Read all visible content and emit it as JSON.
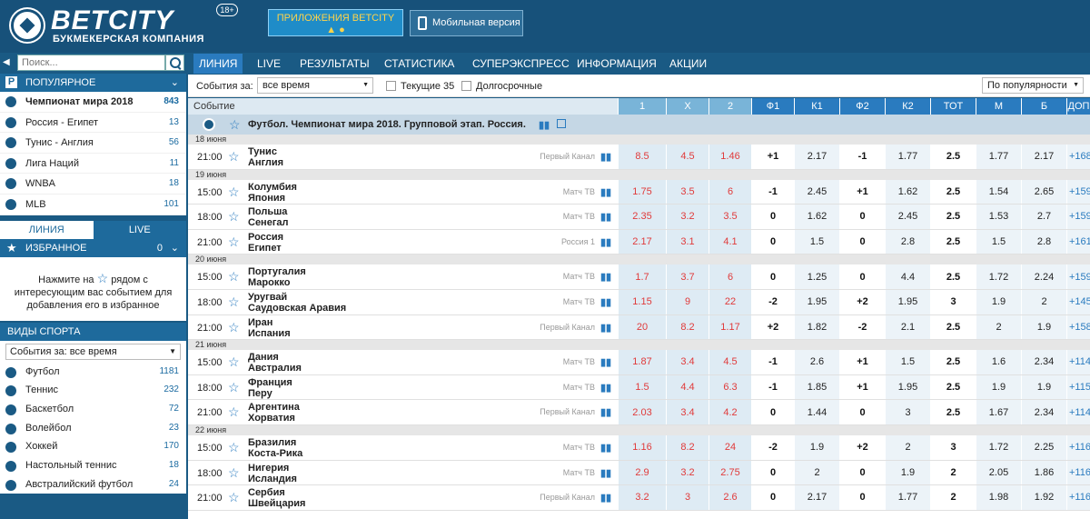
{
  "brand": {
    "name": "BETCITY",
    "subtitle": "БУКМЕКЕРСКАЯ КОМПАНИЯ",
    "age": "18+"
  },
  "header": {
    "apps_label": "ПРИЛОЖЕНИЯ BETCITY",
    "mobile_label": "Мобильная версия"
  },
  "search": {
    "placeholder": "Поиск..."
  },
  "nav": [
    "ЛИНИЯ",
    "LIVE",
    "РЕЗУЛЬТАТЫ",
    "СТАТИСТИКА",
    "СУПЕРЭКСПРЕСС",
    "ИНФОРМАЦИЯ",
    "АКЦИИ"
  ],
  "popular": {
    "title": "ПОПУЛЯРНОЕ",
    "items": [
      {
        "label": "Чемпионат мира 2018",
        "count": "843"
      },
      {
        "label": "Россия - Египет",
        "count": "13"
      },
      {
        "label": "Тунис - Англия",
        "count": "56"
      },
      {
        "label": "Лига Наций",
        "count": "11"
      },
      {
        "label": "WNBA",
        "count": "18"
      },
      {
        "label": "MLB",
        "count": "101"
      }
    ]
  },
  "side_tabs": [
    "ЛИНИЯ",
    "LIVE"
  ],
  "favorites": {
    "title": "ИЗБРАННОЕ",
    "count": "0",
    "hint_1": "Нажмите на",
    "hint_2": "рядом с",
    "hint_3": "интересующим вас событием для",
    "hint_4": "добавления его в избранное"
  },
  "sports": {
    "title": "ВИДЫ СПОРТА",
    "filter": "События за: все время",
    "items": [
      {
        "label": "Футбол",
        "count": "1181"
      },
      {
        "label": "Теннис",
        "count": "232"
      },
      {
        "label": "Баскетбол",
        "count": "72"
      },
      {
        "label": "Волейбол",
        "count": "23"
      },
      {
        "label": "Хоккей",
        "count": "170"
      },
      {
        "label": "Настольный теннис",
        "count": "18"
      },
      {
        "label": "Австралийский футбол",
        "count": "24"
      }
    ]
  },
  "filters": {
    "period_label": "События за:",
    "period_value": "все время",
    "current": "Текущие 35",
    "long": "Долгосрочные",
    "sort": "По популярности"
  },
  "columns": [
    "Событие",
    "1",
    "X",
    "2",
    "Ф1",
    "К1",
    "Ф2",
    "К2",
    "ТОТ",
    "М",
    "Б",
    "ДОП"
  ],
  "league": "Футбол. Чемпионат мира 2018. Групповой этап. Россия.",
  "rows": [
    {
      "date": "18 июня"
    },
    {
      "time": "21:00",
      "t1": "Тунис",
      "t2": "Англия",
      "tv": "Первый Канал",
      "o1": "8.5",
      "ox": "4.5",
      "o2": "1.46",
      "f1": "+1",
      "k1": "2.17",
      "f2": "-1",
      "k2": "1.77",
      "tot": "2.5",
      "m": "1.77",
      "b": "2.17",
      "dop": "+168"
    },
    {
      "date": "19 июня"
    },
    {
      "time": "15:00",
      "t1": "Колумбия",
      "t2": "Япония",
      "tv": "Матч ТВ",
      "o1": "1.75",
      "ox": "3.5",
      "o2": "6",
      "f1": "-1",
      "k1": "2.45",
      "f2": "+1",
      "k2": "1.62",
      "tot": "2.5",
      "m": "1.54",
      "b": "2.65",
      "dop": "+159"
    },
    {
      "time": "18:00",
      "t1": "Польша",
      "t2": "Сенегал",
      "tv": "Матч ТВ",
      "o1": "2.35",
      "ox": "3.2",
      "o2": "3.5",
      "f1": "0",
      "k1": "1.62",
      "f2": "0",
      "k2": "2.45",
      "tot": "2.5",
      "m": "1.53",
      "b": "2.7",
      "dop": "+159"
    },
    {
      "time": "21:00",
      "t1": "Россия",
      "t2": "Египет",
      "tv": "Россия 1",
      "o1": "2.17",
      "ox": "3.1",
      "o2": "4.1",
      "f1": "0",
      "k1": "1.5",
      "f2": "0",
      "k2": "2.8",
      "tot": "2.5",
      "m": "1.5",
      "b": "2.8",
      "dop": "+161"
    },
    {
      "date": "20 июня"
    },
    {
      "time": "15:00",
      "t1": "Португалия",
      "t2": "Марокко",
      "tv": "Матч ТВ",
      "o1": "1.7",
      "ox": "3.7",
      "o2": "6",
      "f1": "0",
      "k1": "1.25",
      "f2": "0",
      "k2": "4.4",
      "tot": "2.5",
      "m": "1.72",
      "b": "2.24",
      "dop": "+159"
    },
    {
      "time": "18:00",
      "t1": "Уругвай",
      "t2": "Саудовская Аравия",
      "tv": "Матч ТВ",
      "o1": "1.15",
      "ox": "9",
      "o2": "22",
      "f1": "-2",
      "k1": "1.95",
      "f2": "+2",
      "k2": "1.95",
      "tot": "3",
      "m": "1.9",
      "b": "2",
      "dop": "+145"
    },
    {
      "time": "21:00",
      "t1": "Иран",
      "t2": "Испания",
      "tv": "Первый Канал",
      "o1": "20",
      "ox": "8.2",
      "o2": "1.17",
      "f1": "+2",
      "k1": "1.82",
      "f2": "-2",
      "k2": "2.1",
      "tot": "2.5",
      "m": "2",
      "b": "1.9",
      "dop": "+158"
    },
    {
      "date": "21 июня"
    },
    {
      "time": "15:00",
      "t1": "Дания",
      "t2": "Австралия",
      "tv": "Матч ТВ",
      "o1": "1.87",
      "ox": "3.4",
      "o2": "4.5",
      "f1": "-1",
      "k1": "2.6",
      "f2": "+1",
      "k2": "1.5",
      "tot": "2.5",
      "m": "1.6",
      "b": "2.34",
      "dop": "+114"
    },
    {
      "time": "18:00",
      "t1": "Франция",
      "t2": "Перу",
      "tv": "Матч ТВ",
      "o1": "1.5",
      "ox": "4.4",
      "o2": "6.3",
      "f1": "-1",
      "k1": "1.85",
      "f2": "+1",
      "k2": "1.95",
      "tot": "2.5",
      "m": "1.9",
      "b": "1.9",
      "dop": "+115"
    },
    {
      "time": "21:00",
      "t1": "Аргентина",
      "t2": "Хорватия",
      "tv": "Первый Канал",
      "o1": "2.03",
      "ox": "3.4",
      "o2": "4.2",
      "f1": "0",
      "k1": "1.44",
      "f2": "0",
      "k2": "3",
      "tot": "2.5",
      "m": "1.67",
      "b": "2.34",
      "dop": "+114"
    },
    {
      "date": "22 июня"
    },
    {
      "time": "15:00",
      "t1": "Бразилия",
      "t2": "Коста-Рика",
      "tv": "Матч ТВ",
      "o1": "1.16",
      "ox": "8.2",
      "o2": "24",
      "f1": "-2",
      "k1": "1.9",
      "f2": "+2",
      "k2": "2",
      "tot": "3",
      "m": "1.72",
      "b": "2.25",
      "dop": "+116"
    },
    {
      "time": "18:00",
      "t1": "Нигерия",
      "t2": "Исландия",
      "tv": "Матч ТВ",
      "o1": "2.9",
      "ox": "3.2",
      "o2": "2.75",
      "f1": "0",
      "k1": "2",
      "f2": "0",
      "k2": "1.9",
      "tot": "2",
      "m": "2.05",
      "b": "1.86",
      "dop": "+116"
    },
    {
      "time": "21:00",
      "t1": "Сербия",
      "t2": "Швейцария",
      "tv": "Первый Канал",
      "o1": "3.2",
      "ox": "3",
      "o2": "2.6",
      "f1": "0",
      "k1": "2.17",
      "f2": "0",
      "k2": "1.77",
      "tot": "2",
      "m": "1.98",
      "b": "1.92",
      "dop": "+116"
    }
  ]
}
